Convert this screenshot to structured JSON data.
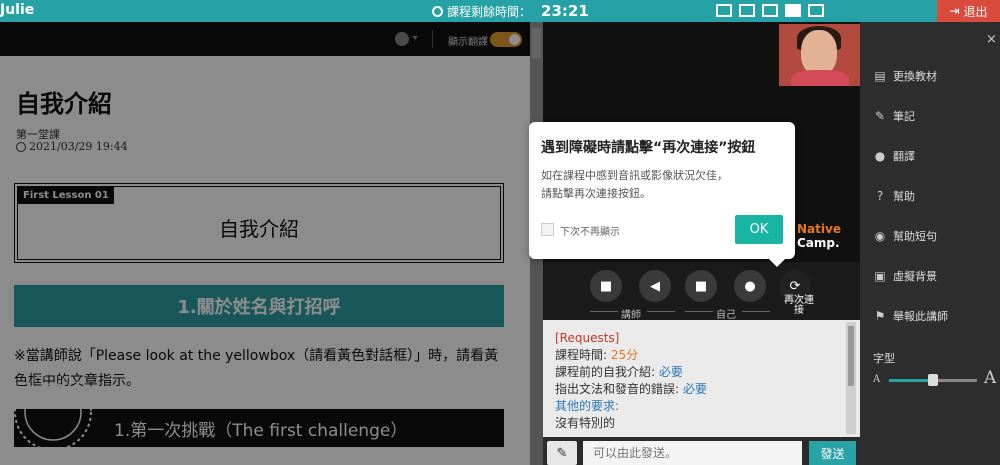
{
  "topbar": {
    "user_name": "Julie",
    "timer_label": "課程剩餘時間：",
    "timer_value": "23:21",
    "exit_label": "退出",
    "colors": {
      "bar": "#26a1a5",
      "exit": "#d94b3d"
    }
  },
  "material": {
    "show_translation_label": "顯示翻譯",
    "show_translation_on": true,
    "title": "自我介紹",
    "lesson_number": "第一堂課",
    "date": "2021/03/29 19:44",
    "box_tag": "First Lesson 01",
    "box_title": "自我介紹",
    "section_title": "1.關於姓名與打招呼",
    "instruction": "※當講師說「Please look at the yellowbox（請看黃色對話框）」時，請看黃色框中的文章指示。",
    "challenge_title": "1.第一次挑戰（The first challenge）"
  },
  "video": {
    "brand_native": "Native",
    "brand_camp": "Camp."
  },
  "controls": {
    "teacher_label": "講師",
    "self_label": "自己",
    "reconnect_label": "再次連接",
    "icons": [
      "camera-icon",
      "speaker-icon",
      "camera-icon",
      "microphone-icon",
      "refresh-icon"
    ]
  },
  "requests": {
    "header": "[Requests]",
    "duration_label": "課程時間: ",
    "duration_value": "25分",
    "self_intro_label": "課程前的自我介紹: ",
    "self_intro_value": "必要",
    "correction_label": "指出文法和發音的錯誤: ",
    "correction_value": "必要",
    "other_label": "其他的要求:",
    "other_value": "沒有特別的"
  },
  "chat": {
    "placeholder": "可以由此發送。",
    "send_label": "發送"
  },
  "side_panel": {
    "close": "×",
    "items": [
      {
        "label": "更換教材",
        "icon": "book-icon"
      },
      {
        "label": "筆記",
        "icon": "edit-icon"
      },
      {
        "label": "翻譯",
        "icon": "globe-icon"
      },
      {
        "label": "幫助",
        "icon": "help-icon"
      },
      {
        "label": "幫助短句",
        "icon": "chat-icon"
      },
      {
        "label": "虛擬背景",
        "icon": "image-icon"
      },
      {
        "label": "舉報此講師",
        "icon": "flag-icon"
      }
    ],
    "font_label": "字型",
    "font_small": "A",
    "font_big": "A",
    "font_level": 0.5
  },
  "popup": {
    "title": "遇到障礙時請點擊“再次連接”按鈕",
    "body_line1": "如在課程中感到音訊或影像狀況欠佳，",
    "body_line2": "請點擊再次連接按鈕。",
    "checkbox_label": "下次不再顯示",
    "ok_label": "OK"
  }
}
